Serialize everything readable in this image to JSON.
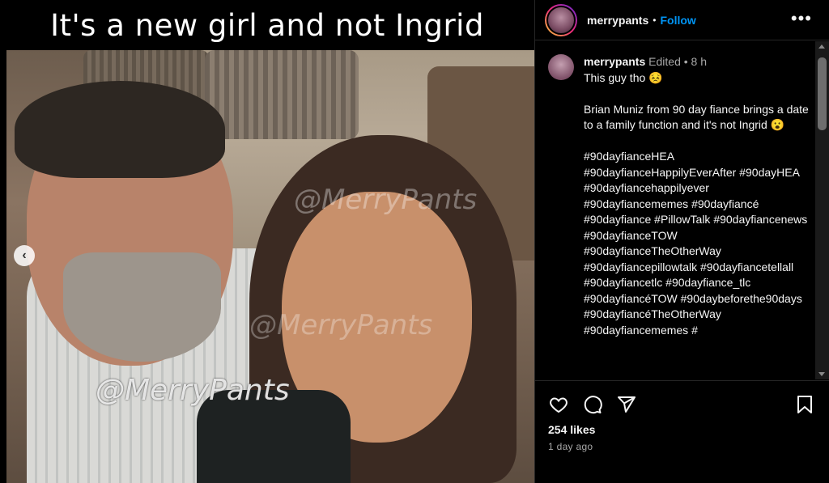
{
  "media": {
    "caption": "It's a new girl and not Ingrid",
    "watermark": "@MerryPants",
    "prev_arrow": "‹"
  },
  "post": {
    "username": "merrypants",
    "follow_label": "Follow",
    "more_label": "•••"
  },
  "comment": {
    "username": "merrypants",
    "edited": "Edited",
    "age": "8 h",
    "lines": [
      "This guy tho 😣",
      "",
      "Brian Muniz from 90 day fiance brings a date to a family function and it's not Ingrid 😮",
      "",
      "#90dayfianceHEA #90dayfianceHappilyEverAfter #90dayHEA #90dayfiancehappilyever #90dayfiancememes #90dayfiancé #90dayfiance #PillowTalk #90dayfiancenews #90dayfianceTOW #90dayfianceTheOtherWay #90dayfiancepillowtalk #90dayfiancetellall #90dayfiancetlc #90dayfiance_tlc #90dayfiancéTOW #90daybeforethe90days #90dayfiancéTheOtherWay #90dayfiancememes #"
    ]
  },
  "actions": {
    "likes": "254 likes",
    "posted": "1 day ago",
    "icons": [
      "heart-icon",
      "comment-icon",
      "share-icon",
      "bookmark-icon"
    ]
  }
}
